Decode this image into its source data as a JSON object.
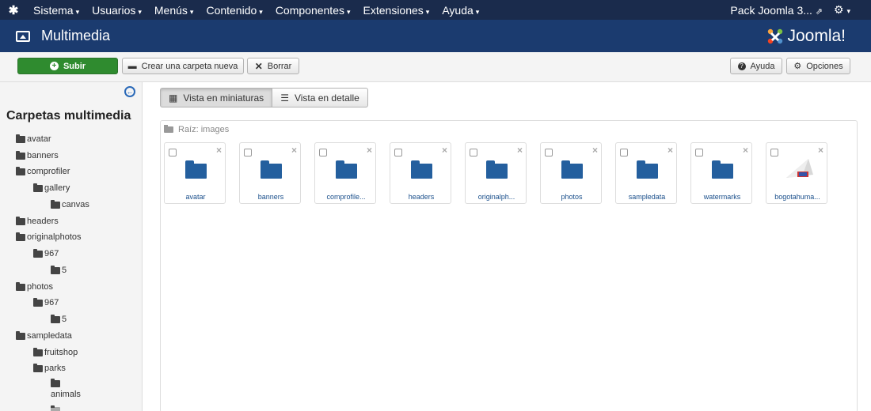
{
  "navbar": {
    "menu": [
      {
        "label": "Sistema"
      },
      {
        "label": "Usuarios"
      },
      {
        "label": "Menús"
      },
      {
        "label": "Contenido"
      },
      {
        "label": "Componentes"
      },
      {
        "label": "Extensiones"
      },
      {
        "label": "Ayuda"
      }
    ],
    "site_label": "Pack Joomla 3...",
    "caret": "▾",
    "external_icon": "external-link-icon",
    "settings_icon": "gear-icon"
  },
  "header": {
    "title": "Multimedia",
    "brand": "Joomla!",
    "icon": "image-icon"
  },
  "toolbar": {
    "upload": "Subir",
    "new_folder": "Crear una carpeta nueva",
    "delete": "Borrar",
    "help": "Ayuda",
    "options": "Opciones"
  },
  "sidebar": {
    "title": "Carpetas multimedia",
    "collapse_icon": "arrow-left-circle-icon",
    "items": [
      {
        "label": "avatar",
        "level": 0
      },
      {
        "label": "banners",
        "level": 0
      },
      {
        "label": "comprofiler",
        "level": 0
      },
      {
        "label": "gallery",
        "level": 1
      },
      {
        "label": "canvas",
        "level": 2
      },
      {
        "label": "headers",
        "level": 0
      },
      {
        "label": "originalphotos",
        "level": 0
      },
      {
        "label": "967",
        "level": 1
      },
      {
        "label": "5",
        "level": 2
      },
      {
        "label": "photos",
        "level": 0
      },
      {
        "label": "967",
        "level": 1
      },
      {
        "label": "5",
        "level": 2
      },
      {
        "label": "sampledata",
        "level": 0
      },
      {
        "label": "fruitshop",
        "level": 1
      },
      {
        "label": "parks",
        "level": 1
      },
      {
        "label": "animals",
        "level": 2
      }
    ]
  },
  "views": {
    "thumbs": "Vista en miniaturas",
    "detail": "Vista en detalle",
    "active": "thumbs"
  },
  "browser": {
    "breadcrumb": "Raíz: images",
    "items": [
      {
        "name": "avatar",
        "type": "folder"
      },
      {
        "name": "banners",
        "type": "folder"
      },
      {
        "name": "comprofile...",
        "type": "folder"
      },
      {
        "name": "headers",
        "type": "folder"
      },
      {
        "name": "originalph...",
        "type": "folder"
      },
      {
        "name": "photos",
        "type": "folder"
      },
      {
        "name": "sampledata",
        "type": "folder"
      },
      {
        "name": "watermarks",
        "type": "folder"
      },
      {
        "name": "bogotahuma...",
        "type": "image"
      }
    ]
  },
  "colors": {
    "navbar": "#1a2b4c",
    "header": "#1b3b6f",
    "upload_button": "#2f8b2f",
    "folder": "#245f9e"
  }
}
